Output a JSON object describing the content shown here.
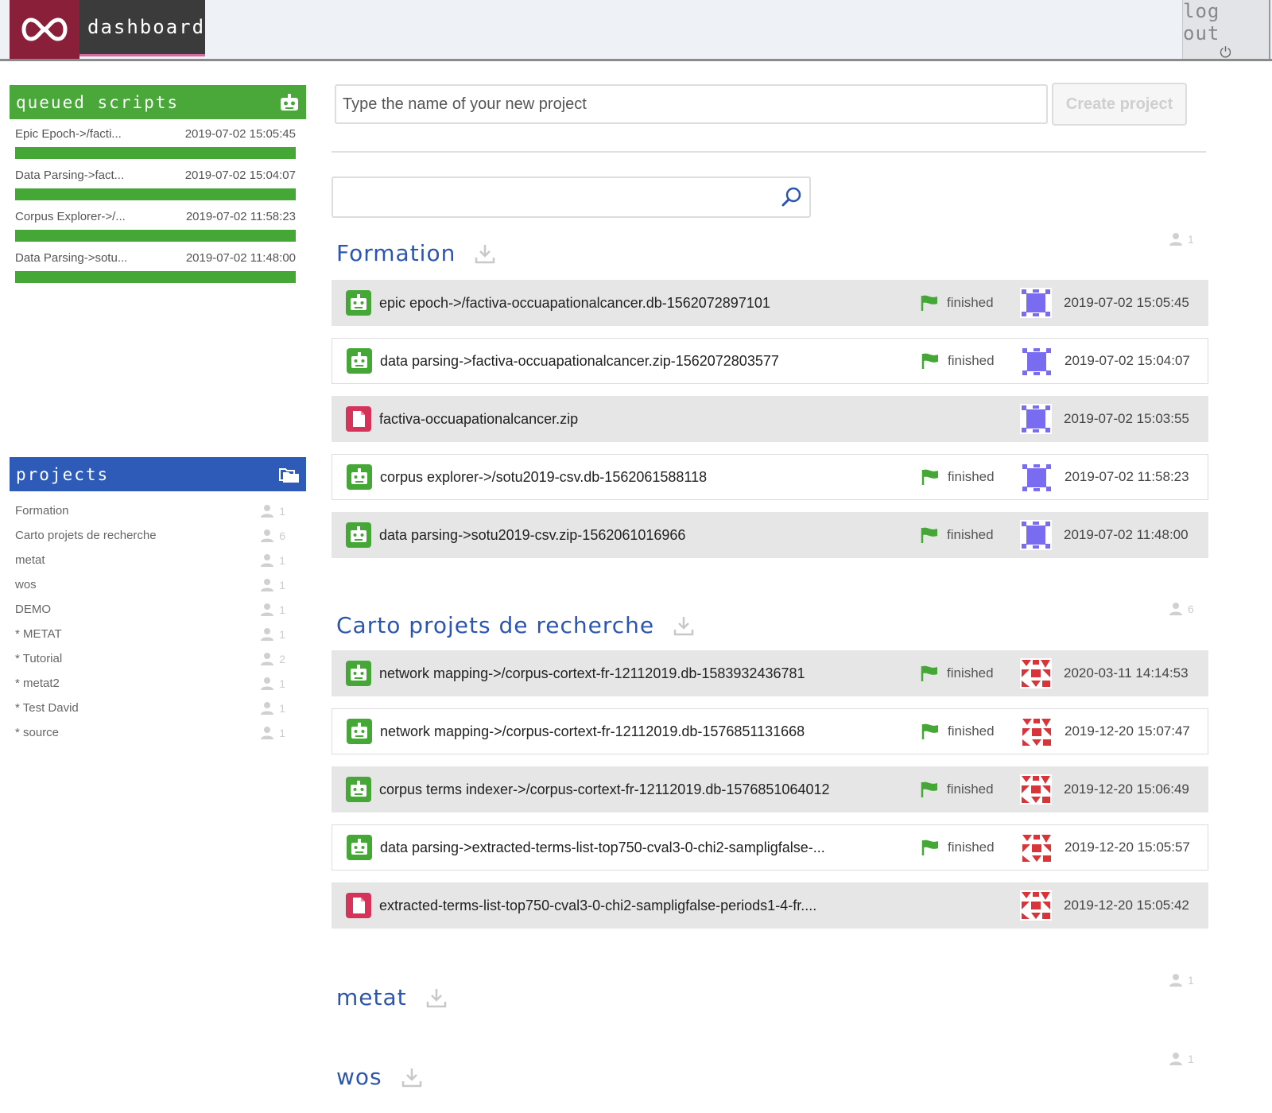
{
  "header": {
    "brand": "dashboard",
    "logout_label": "log out"
  },
  "queued": {
    "title": "queued scripts",
    "items": [
      {
        "name": "Epic Epoch->/facti...",
        "time": "2019-07-02 15:05:45",
        "progress": 1.0
      },
      {
        "name": "Data Parsing->fact...",
        "time": "2019-07-02 15:04:07",
        "progress": 1.0
      },
      {
        "name": "Corpus Explorer->/...",
        "time": "2019-07-02 11:58:23",
        "progress": 1.0
      },
      {
        "name": "Data Parsing->sotu...",
        "time": "2019-07-02 11:48:00",
        "progress": 1.0
      }
    ]
  },
  "projects_panel": {
    "title": "projects",
    "items": [
      {
        "name": "Formation",
        "users": "1"
      },
      {
        "name": "Carto projets de recherche",
        "users": "6"
      },
      {
        "name": "metat",
        "users": "1"
      },
      {
        "name": "wos",
        "users": "1"
      },
      {
        "name": "DEMO",
        "users": "1"
      },
      {
        "name": "* METAT",
        "users": "1"
      },
      {
        "name": "* Tutorial",
        "users": "2"
      },
      {
        "name": "* metat2",
        "users": "1"
      },
      {
        "name": "* Test David",
        "users": "1"
      },
      {
        "name": "* source",
        "users": "1"
      }
    ]
  },
  "new_project": {
    "placeholder": "Type the name of your new project",
    "create_label": "Create project"
  },
  "search": {
    "placeholder": ""
  },
  "sections": [
    {
      "title": "Formation",
      "users": "1",
      "rows": [
        {
          "kind": "script",
          "name": "epic epoch->/factiva-occuapationalcancer.db-1562072897101",
          "status": "finished",
          "date": "2019-07-02 15:05:45"
        },
        {
          "kind": "script",
          "name": "data parsing->factiva-occuapationalcancer.zip-1562072803577",
          "status": "finished",
          "date": "2019-07-02 15:04:07"
        },
        {
          "kind": "file",
          "name": "factiva-occuapationalcancer.zip",
          "status": "",
          "date": "2019-07-02 15:03:55"
        },
        {
          "kind": "script",
          "name": "corpus explorer->/sotu2019-csv.db-1562061588118",
          "status": "finished",
          "date": "2019-07-02 11:58:23"
        },
        {
          "kind": "script",
          "name": "data parsing->sotu2019-csv.zip-1562061016966",
          "status": "finished",
          "date": "2019-07-02 11:48:00"
        }
      ]
    },
    {
      "title": "Carto projets de recherche",
      "users": "6",
      "rows": [
        {
          "kind": "script",
          "name": "network mapping->/corpus-cortext-fr-12112019.db-1583932436781",
          "status": "finished",
          "date": "2020-03-11 14:14:53"
        },
        {
          "kind": "script",
          "name": "network mapping->/corpus-cortext-fr-12112019.db-1576851131668",
          "status": "finished",
          "date": "2019-12-20 15:07:47"
        },
        {
          "kind": "script",
          "name": "corpus terms indexer->/corpus-cortext-fr-12112019.db-1576851064012",
          "status": "finished",
          "date": "2019-12-20 15:06:49"
        },
        {
          "kind": "script",
          "name": "data parsing->extracted-terms-list-top750-cval3-0-chi2-sampligfalse-...",
          "status": "finished",
          "date": "2019-12-20 15:05:57"
        },
        {
          "kind": "file",
          "name": "extracted-terms-list-top750-cval3-0-chi2-sampligfalse-periods1-4-fr....",
          "status": "",
          "date": "2019-12-20 15:05:42"
        }
      ]
    },
    {
      "title": "metat",
      "users": "1",
      "rows": []
    },
    {
      "title": "wos",
      "users": "1",
      "rows": []
    }
  ],
  "colors": {
    "accent_green": "#4aa73a",
    "accent_blue": "#2e5ab8",
    "file_red": "#d6335a",
    "avatar_purple": "#7a6cf0",
    "avatar_red": "#d8343a"
  }
}
